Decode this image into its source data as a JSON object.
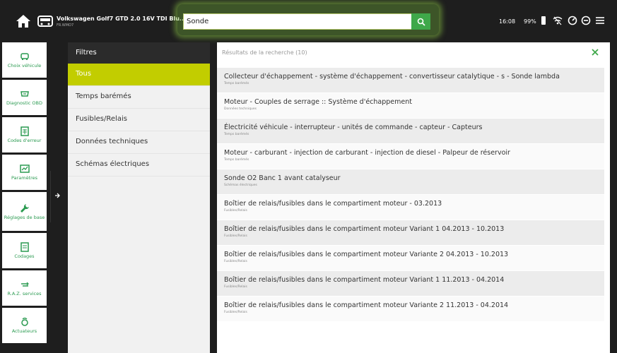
{
  "topbar": {
    "vehicle_title": "Volkswagen Golf7 GTD 2.0 16V TDI Blu...",
    "vehicle_sub": "FR.WMO7",
    "search_value": "Sonde",
    "time": "16:08",
    "battery": "99%"
  },
  "sidebar": {
    "items": [
      {
        "label": "Choix véhicule"
      },
      {
        "label": "Diagnostic OBD"
      },
      {
        "label": "Codes d'erreur"
      },
      {
        "label": "Paramètres"
      },
      {
        "label": "Réglages de base"
      },
      {
        "label": "Codages"
      },
      {
        "label": "R.A.Z. services"
      },
      {
        "label": "Actuateurs"
      }
    ]
  },
  "filters": {
    "header": "Filtres",
    "items": [
      {
        "label": "Tous"
      },
      {
        "label": "Temps barémés"
      },
      {
        "label": "Fusibles/Relais"
      },
      {
        "label": "Données techniques"
      },
      {
        "label": "Schémas électriques"
      }
    ]
  },
  "results": {
    "header": "Résultats de la recherche (10)",
    "items": [
      {
        "title": "Collecteur d'échappement - système d'échappement - convertisseur catalytique - s - Sonde lambda",
        "category": "Temps barémés"
      },
      {
        "title": "Moteur - Couples de serrage :: Système d'échappement",
        "category": "Données techniques"
      },
      {
        "title": "Électricité véhicule - interrupteur - unités de commande - capteur - Capteurs",
        "category": "Temps barémés"
      },
      {
        "title": "Moteur - carburant - injection de carburant - injection de diesel - Palpeur de réservoir",
        "category": "Temps barémés"
      },
      {
        "title": "Sonde O2 Banc 1 avant catalyseur",
        "category": "Schémas électriques"
      },
      {
        "title": "Boîtier de relais/fusibles dans le compartiment moteur - 03.2013",
        "category": "Fusibles/Relais"
      },
      {
        "title": "Boîtier de relais/fusibles dans le compartiment moteur Variant 1 04.2013 - 10.2013",
        "category": "Fusibles/Relais"
      },
      {
        "title": "Boîtier de relais/fusibles dans le compartiment moteur Variante 2 04.2013 - 10.2013",
        "category": "Fusibles/Relais"
      },
      {
        "title": "Boîtier de relais/fusibles dans le compartiment moteur Variant 1 11.2013 - 04.2014",
        "category": "Fusibles/Relais"
      },
      {
        "title": "Boîtier de relais/fusibles dans le compartiment moteur Variante 2 11.2013 - 04.2014",
        "category": "Fusibles/Relais"
      }
    ]
  },
  "colors": {
    "accent_green": "#3fa84a",
    "active_filter": "#c2cd00",
    "sidebar_label": "#2a9a50"
  }
}
